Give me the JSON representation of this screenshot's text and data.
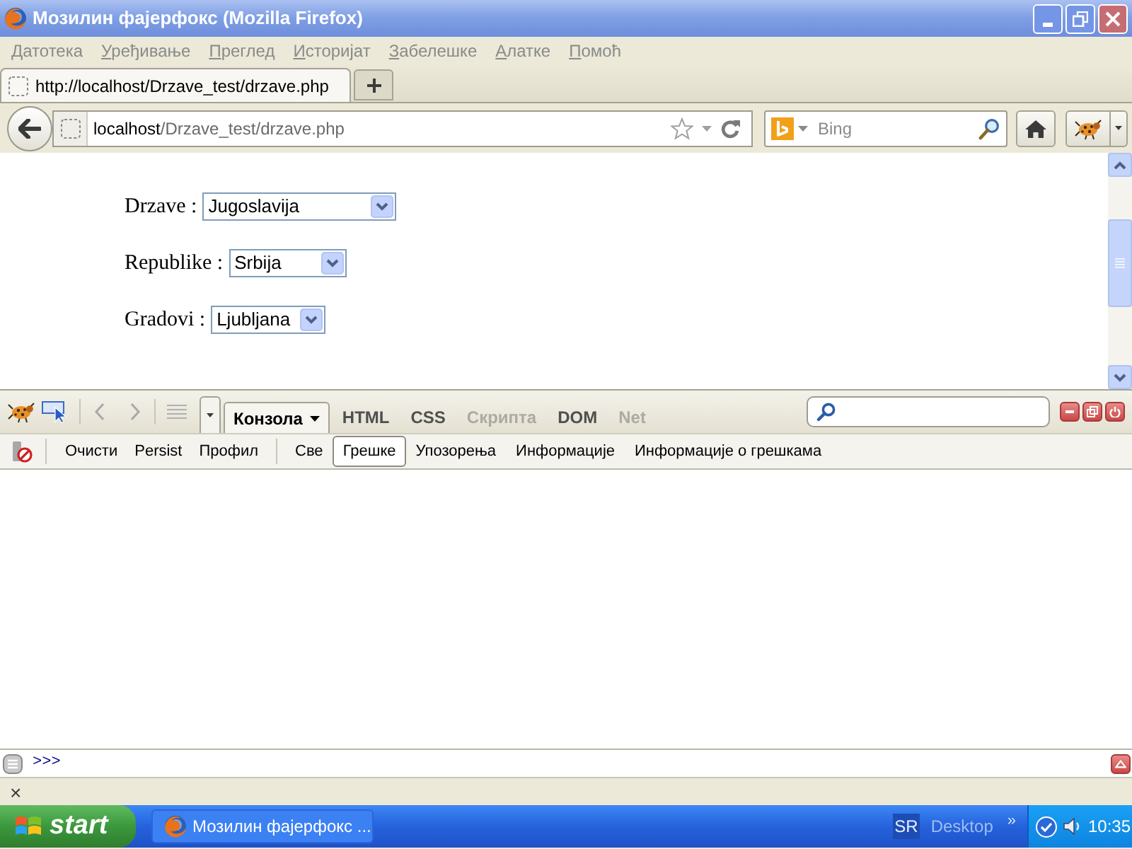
{
  "window": {
    "title": "Мозилин фајерфокс (Mozilla Firefox)"
  },
  "menu_bar": [
    "Датотека",
    "Уређивање",
    "Преглед",
    "Историјат",
    "Забелешке",
    "Алатке",
    "Помоћ"
  ],
  "tabs": [
    {
      "label": "http://localhost/Drzave_test/drzave.php",
      "selected": true
    }
  ],
  "address_bar": {
    "host": "localhost",
    "path": "/Drzave_test/drzave.php"
  },
  "search": {
    "placeholder": "Bing"
  },
  "page": {
    "fields": [
      {
        "label": "Drzave :",
        "value": "Jugoslavija"
      },
      {
        "label": "Republike :",
        "value": "Srbija"
      },
      {
        "label": "Gradovi :",
        "value": "Ljubljana"
      }
    ]
  },
  "firebug": {
    "panels": [
      {
        "label": "Конзола",
        "selected": true,
        "disabled": false
      },
      {
        "label": "HTML",
        "selected": false,
        "disabled": false
      },
      {
        "label": "CSS",
        "selected": false,
        "disabled": false
      },
      {
        "label": "Скрипта",
        "selected": false,
        "disabled": true
      },
      {
        "label": "DOM",
        "selected": false,
        "disabled": false
      },
      {
        "label": "Net",
        "selected": false,
        "disabled": true
      }
    ],
    "console_actions": [
      "Очисти",
      "Persist",
      "Профил"
    ],
    "console_filters": [
      {
        "label": "Све",
        "selected": false
      },
      {
        "label": "Грешке",
        "selected": true
      },
      {
        "label": "Упозорења",
        "selected": false
      },
      {
        "label": "Информације",
        "selected": false
      },
      {
        "label": "Информације о грешкама",
        "selected": false
      }
    ],
    "command_line": {
      "prompt": ">>>"
    }
  },
  "status_bar": {
    "close": "×"
  },
  "taskbar": {
    "start": "start",
    "tasks": [
      {
        "label": "Мозилин фајерфокс ...",
        "selected": false
      }
    ],
    "language": "SR",
    "toolbar": "Desktop",
    "chevron": "»",
    "clock": "10:35"
  }
}
